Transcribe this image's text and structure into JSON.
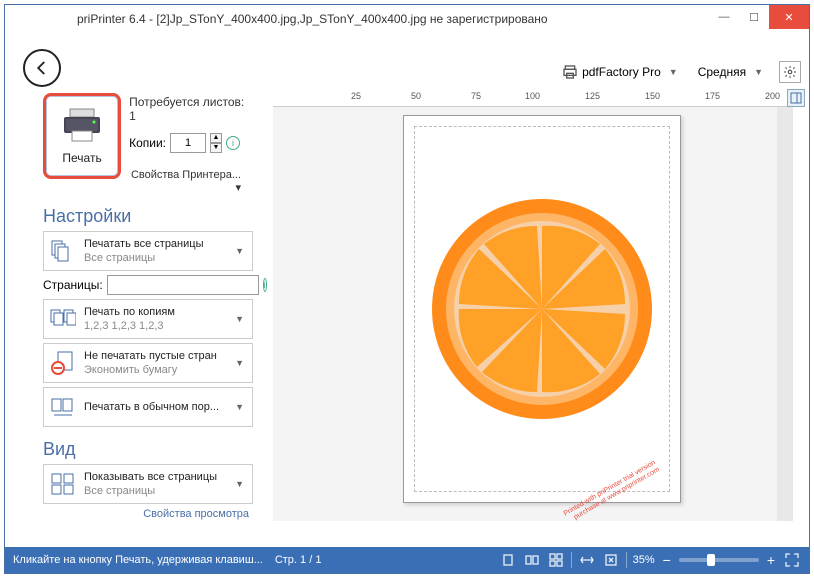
{
  "title": "priPrinter 6.4 - [2]Jp_STonY_400x400.jpg,Jp_STonY_400x400.jpg не зарегистрировано",
  "topbar": {
    "printer": "pdfFactory Pro",
    "quality": "Средняя"
  },
  "print": {
    "label": "Печать",
    "sheets_required": "Потребуется листов: 1",
    "copies_label": "Копии:",
    "copies_value": "1",
    "printer_props": "Свойства Принтера... ▾"
  },
  "settings": {
    "header": "Настройки",
    "print_all": {
      "title": "Печатать все страницы",
      "sub": "Все страницы"
    },
    "pages_label": "Страницы:",
    "pages_value": "",
    "collate": {
      "title": "Печать по копиям",
      "sub": "1,2,3  1,2,3  1,2,3"
    },
    "skip_empty": {
      "title": "Не печатать пустые стран",
      "sub": "Экономить бумагу"
    },
    "normal_order": {
      "title": "Печатать в обычном пор..."
    }
  },
  "view": {
    "header": "Вид",
    "show_all": {
      "title": "Показывать все страницы",
      "sub": "Все страницы"
    },
    "view_props": "Свойства просмотра"
  },
  "ruler": {
    "ticks": [
      "25",
      "50",
      "75",
      "100",
      "125",
      "150",
      "175",
      "200"
    ]
  },
  "watermark": {
    "line1": "Printed with priPrinter trial version",
    "line2": "purchase at www.priprinter.com"
  },
  "statusbar": {
    "hint": "Кликайте на кнопку Печать, удерживая клавиш...",
    "page": "Стр. 1 / 1",
    "zoom": "35%"
  }
}
